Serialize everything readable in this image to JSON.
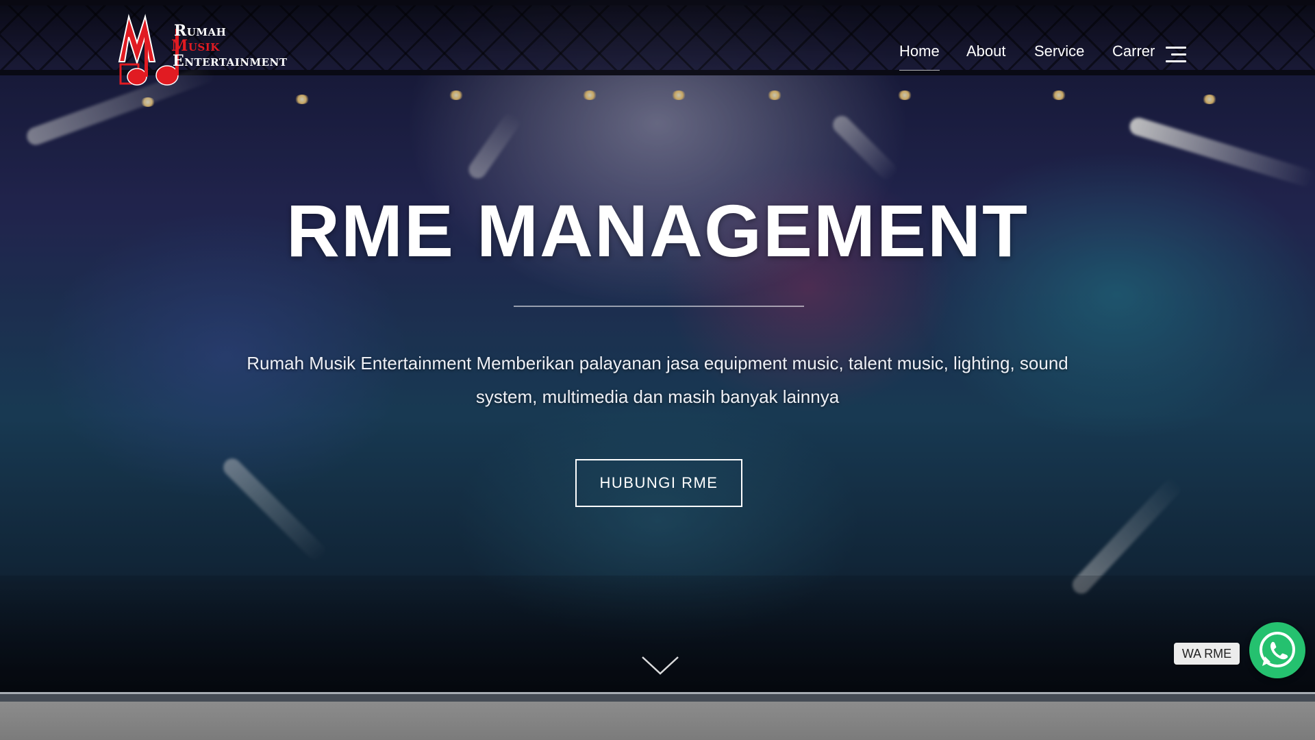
{
  "brand": {
    "logo_line1": "Rumah",
    "logo_line2": "Musik",
    "logo_line3": "Entertainment",
    "logo_colors": {
      "red": "#e11b22",
      "white": "#ffffff"
    }
  },
  "nav": {
    "items": [
      {
        "label": "Home",
        "active": true
      },
      {
        "label": "About",
        "active": false
      },
      {
        "label": "Service",
        "active": false
      },
      {
        "label": "Carrer",
        "active": false
      }
    ],
    "menu_icon": "hamburger-menu-icon"
  },
  "hero": {
    "title": "RME MANAGEMENT",
    "description_line1": "Rumah Musik Entertainment Memberikan palayanan jasa equipment music, talent music, lighting, sound",
    "description_line2": "system, multimedia dan masih banyak lainnya",
    "cta_label": "HUBUNGI RME",
    "scroll_icon": "chevron-down-icon"
  },
  "whatsapp": {
    "label": "WA RME",
    "icon": "whatsapp-icon",
    "color": "#25c16f"
  }
}
